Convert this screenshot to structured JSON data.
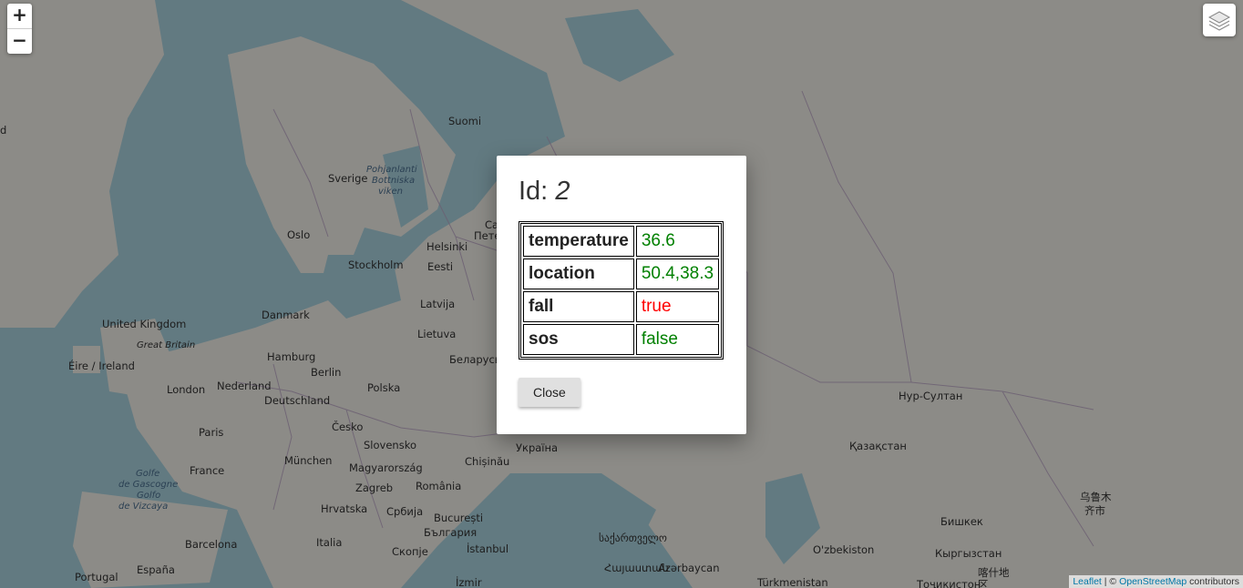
{
  "map": {
    "zoom_in": "+",
    "zoom_out": "−",
    "layers_icon": "layers-icon",
    "labels": [
      "Suomi",
      "Sverige",
      "Pohjanlanti",
      "Bottniska",
      "viken",
      "Oslo",
      "Stockholm",
      "Helsinki",
      "Eesti",
      "Latvija",
      "Danmark",
      "Lietuva",
      "United Kingdom",
      "Great Britain",
      "Éire / Ireland",
      "Hamburg",
      "Berlin",
      "Nederland",
      "Polska",
      "Беларусь",
      "London",
      "Deutschland",
      "Česko",
      "Paris",
      "Slovensko",
      "Україна",
      "München",
      "Magyarország",
      "Chișinău",
      "France",
      "Zagreb",
      "România",
      "Golfe",
      "de Gascogne",
      "Golfo",
      "de Vizcaya",
      "Hrvatska",
      "Србија",
      "București",
      "България",
      "Barcelona",
      "Italia",
      "Скопје",
      "İstanbul",
      "საქართველო",
      "España",
      "Portugal",
      "İzmir",
      "Հայաստան",
      "Azərbaycan",
      "Türkmenistan",
      "O'zbekiston",
      "Қазақстан",
      "Нур-Султан",
      "Бишкек",
      "Кыргызстан",
      "Тоҷикистон",
      "乌鲁木",
      "齐市",
      "喀什地",
      "区",
      "Петер",
      "d",
      "Са"
    ]
  },
  "attribution": {
    "leaflet": "Leaflet",
    "sep": " | © ",
    "osm": "OpenStreetMap",
    "rest": " contributors"
  },
  "modal": {
    "title_prefix": "Id: ",
    "title_id": "2",
    "rows": [
      {
        "key": "temperature",
        "value": "36.6",
        "color": "#008000"
      },
      {
        "key": "location",
        "value": "50.4,38.3",
        "color": "#008000"
      },
      {
        "key": "fall",
        "value": "true",
        "color": "#ff0000"
      },
      {
        "key": "sos",
        "value": "false",
        "color": "#008000"
      }
    ],
    "close_label": "Close"
  }
}
